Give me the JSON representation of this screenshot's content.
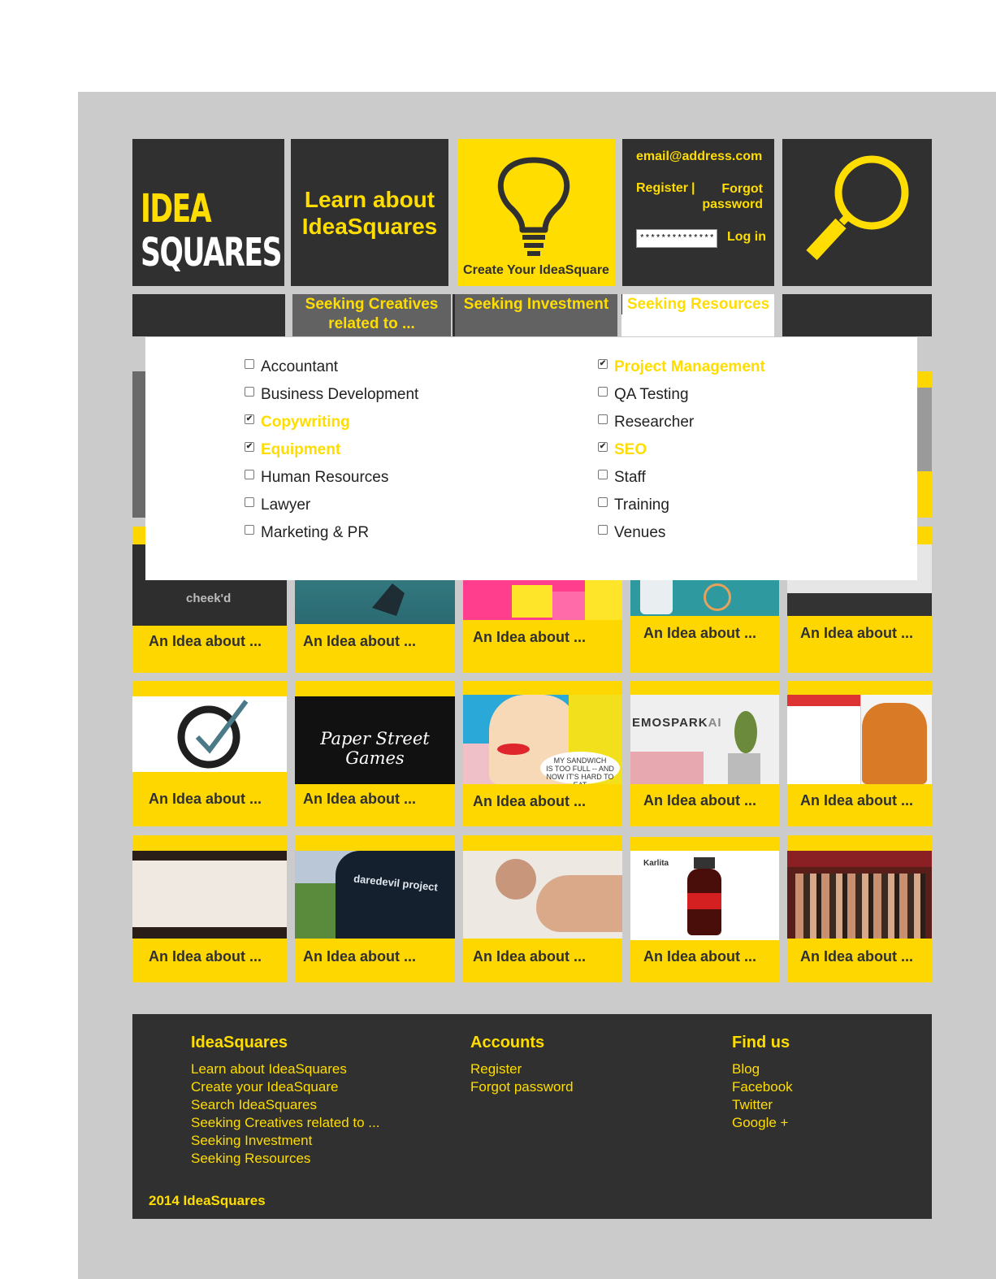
{
  "header": {
    "logo": {
      "line1": "IDEA",
      "line2": "SQUARES"
    },
    "learn_tile": {
      "label": "Learn about IdeaSquares",
      "icon": "lightbulb-icon"
    },
    "create_tile": {
      "label": "Create Your IdeaSquare",
      "icon": "lightbulb-icon"
    },
    "login": {
      "email": "email@address.com",
      "register": "Register",
      "separator": "|",
      "forgot": "Forgot password",
      "password_value": "****************",
      "login_label": "Log in"
    },
    "search_tile": {
      "icon": "search-icon"
    }
  },
  "nav": {
    "tabs": [
      {
        "label": "Seeking Creatives related to ..."
      },
      {
        "label": "Seeking Investment"
      },
      {
        "label": "Seeking Resources"
      }
    ]
  },
  "filter_panel": {
    "left": [
      {
        "label": "Accountant",
        "checked": false
      },
      {
        "label": "Business Development",
        "checked": false
      },
      {
        "label": "Copywriting",
        "checked": true
      },
      {
        "label": "Equipment",
        "checked": true
      },
      {
        "label": "Human Resources",
        "checked": false
      },
      {
        "label": "Lawyer",
        "checked": false
      },
      {
        "label": "Marketing & PR",
        "checked": false
      }
    ],
    "right": [
      {
        "label": "Project Management",
        "checked": true
      },
      {
        "label": "QA Testing",
        "checked": false
      },
      {
        "label": "Researcher",
        "checked": false
      },
      {
        "label": "SEO",
        "checked": true
      },
      {
        "label": "Staff",
        "checked": false
      },
      {
        "label": "Training",
        "checked": false
      },
      {
        "label": "Venues",
        "checked": false
      }
    ]
  },
  "grid": {
    "card_label": "An Idea about ...",
    "thumb_texts": {
      "cheekd": "cheek'd",
      "paper_street": "Paper Street Games",
      "emospark": "EMOSPARK",
      "emospark_suffix": "AI",
      "comic_line1": "MY SANDWICH",
      "comic_line2": "IS TOO FULL -- AND",
      "comic_line3": "NOW IT'S HARD TO EAT",
      "daredevil": "daredevil project",
      "karlita": "Karlita"
    }
  },
  "footer": {
    "col1": {
      "title": "IdeaSquares",
      "links": [
        "Learn about IdeaSquares",
        "Create your IdeaSquare",
        "Search IdeaSquares",
        "Seeking Creatives related to ...",
        "Seeking Investment",
        "Seeking Resources"
      ]
    },
    "col2": {
      "title": "Accounts",
      "links": [
        "Register",
        "Forgot password"
      ]
    },
    "col3": {
      "title": "Find us",
      "links": [
        "Blog",
        "Facebook",
        "Twitter",
        "Google +"
      ]
    },
    "copyright": "2014 IdeaSquares"
  },
  "colors": {
    "accent": "#ffdd00",
    "dark": "#303030",
    "card": "#ffd700",
    "canvas": "#cbcbcb"
  }
}
